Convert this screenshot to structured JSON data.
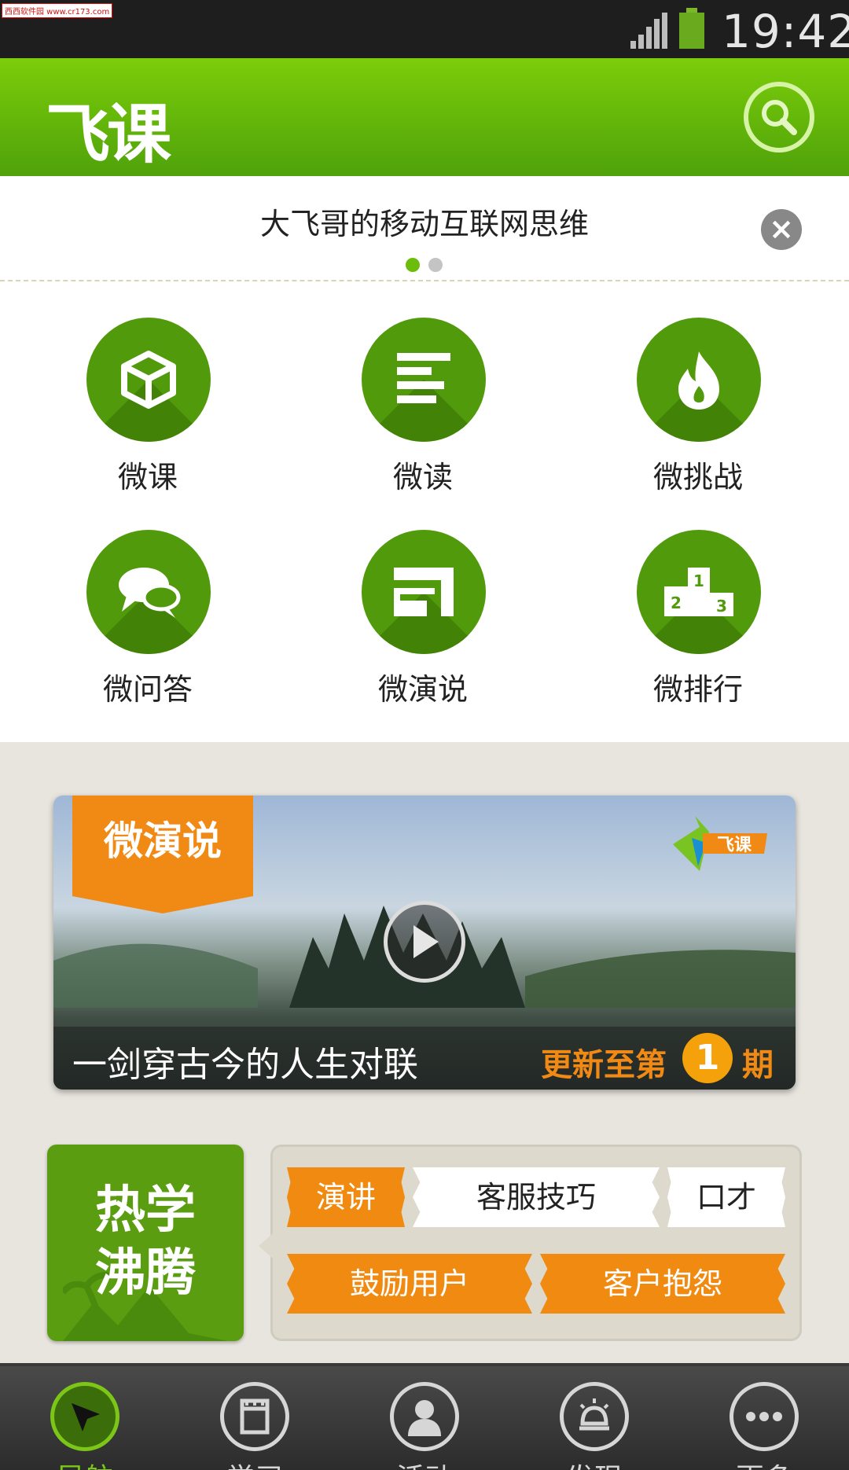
{
  "status_bar": {
    "watermark": "西西软件园 www.cr173.com",
    "time": "19:42"
  },
  "header": {
    "title": "飞课",
    "search_icon": "search-icon"
  },
  "notice": {
    "text": "大飞哥的移动互联网思维",
    "close_icon": "close-icon",
    "pager": {
      "count": 2,
      "active": 1
    }
  },
  "grid": {
    "items": [
      {
        "label": "微课",
        "icon": "cube-icon"
      },
      {
        "label": "微读",
        "icon": "text-lines-icon"
      },
      {
        "label": "微挑战",
        "icon": "flame-icon"
      },
      {
        "label": "微问答",
        "icon": "chat-bubbles-icon"
      },
      {
        "label": "微演说",
        "icon": "screen-icon"
      },
      {
        "label": "微排行",
        "icon": "podium-icon"
      }
    ],
    "podium_numbers": [
      "1",
      "2",
      "3"
    ]
  },
  "feature": {
    "tag": "微演说",
    "brand": "飞课",
    "caption": "一剑穿古今的人生对联",
    "update_prefix": "更新至第",
    "update_number": "1",
    "update_suffix": "期"
  },
  "hot": {
    "line1": "热学",
    "line2": "沸腾",
    "tags": [
      {
        "label": "演讲",
        "style": "orange"
      },
      {
        "label": "客服技巧",
        "style": "white"
      },
      {
        "label": "口才",
        "style": "white"
      },
      {
        "label": "鼓励用户",
        "style": "orange"
      },
      {
        "label": "客户抱怨",
        "style": "orange"
      }
    ]
  },
  "bottom_nav": {
    "items": [
      {
        "label": "导航",
        "icon": "cursor-icon",
        "active": true
      },
      {
        "label": "学习",
        "icon": "notebook-icon",
        "active": false
      },
      {
        "label": "活动",
        "icon": "person-icon",
        "active": false
      },
      {
        "label": "发现",
        "icon": "lightbulb-icon",
        "active": false
      },
      {
        "label": "更多",
        "icon": "more-icon",
        "active": false
      }
    ]
  },
  "colors": {
    "brand_green": "#5aa50c",
    "accent_orange": "#f08a10",
    "header_gradient_top": "#7ccd0a",
    "header_gradient_bottom": "#4fa20a"
  }
}
